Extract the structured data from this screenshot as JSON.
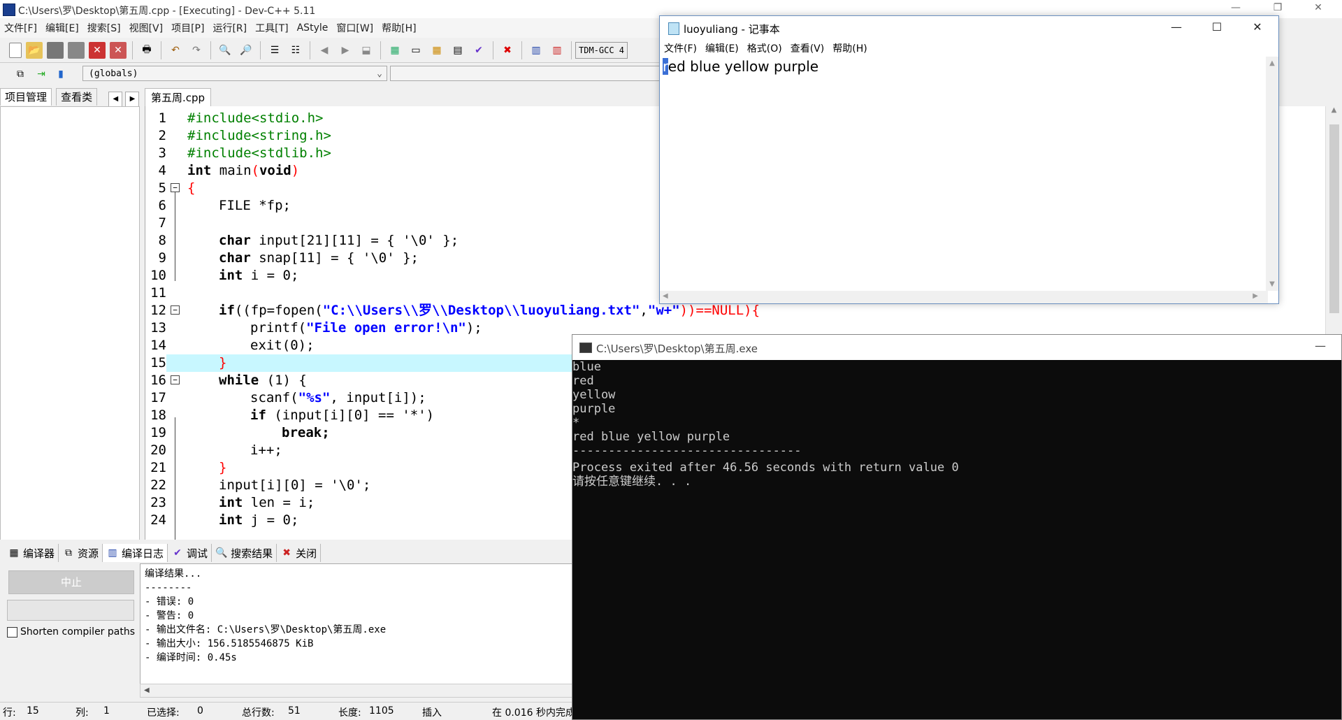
{
  "devcpp": {
    "window_title": "C:\\Users\\罗\\Desktop\\第五周.cpp - [Executing] - Dev-C++ 5.11",
    "menu": [
      "文件[F]",
      "编辑[E]",
      "搜索[S]",
      "视图[V]",
      "项目[P]",
      "运行[R]",
      "工具[T]",
      "AStyle",
      "窗口[W]",
      "帮助[H]"
    ],
    "compiler_label": "TDM-GCC 4",
    "globals_combo": "(globals)",
    "left_tabs": [
      "项目管理",
      "查看类"
    ],
    "editor_tab": "第五周.cpp",
    "code_lines": [
      {
        "n": "1"
      },
      {
        "n": "2"
      },
      {
        "n": "3"
      },
      {
        "n": "4"
      },
      {
        "n": "5"
      },
      {
        "n": "6"
      },
      {
        "n": "7"
      },
      {
        "n": "8"
      },
      {
        "n": "9"
      },
      {
        "n": "10"
      },
      {
        "n": "11"
      },
      {
        "n": "12"
      },
      {
        "n": "13"
      },
      {
        "n": "14"
      },
      {
        "n": "15"
      },
      {
        "n": "16"
      },
      {
        "n": "17"
      },
      {
        "n": "18"
      },
      {
        "n": "19"
      },
      {
        "n": "20"
      },
      {
        "n": "21"
      },
      {
        "n": "22"
      },
      {
        "n": "23"
      },
      {
        "n": "24"
      }
    ],
    "code_text": {
      "l1": "#include<stdio.h>",
      "l2": "#include<string.h>",
      "l3": "#include<stdlib.h>",
      "l4_kw": "int",
      "l4_rest": " main",
      "l4_void": "void",
      "l6": "FILE *fp;",
      "l8_kw": "char",
      "l8_rest": " input[21][11] = { '\\0' };",
      "l9_kw": "char",
      "l9_rest": " snap[11] = { '\\0' };",
      "l10_kw": "int",
      "l10_rest": " i = 0;",
      "l12_kw": "if",
      "l12_a": "((fp=fopen(",
      "l12_str": "\"C:\\\\Users\\\\罗\\\\Desktop\\\\luoyuliang.txt\"",
      "l12_comma": ",",
      "l12_str2": "\"w+\"",
      "l12_b": "))==NULL){",
      "l13_a": "printf(",
      "l13_str": "\"File open error!\\n\"",
      "l13_b": ");",
      "l14": "exit(0);",
      "l16_kw": "while",
      "l16_rest": " (1) {",
      "l17_a": "scanf(",
      "l17_str": "\"%s\"",
      "l17_b": ", input[i]);",
      "l18_kw": "if",
      "l18_rest": " (input[i][0] == '*')",
      "l19": "break;",
      "l20": "i++;",
      "l22": "input[i][0] = '\\0';",
      "l23_kw": "int",
      "l23_rest": " len = i;",
      "l24_kw": "int",
      "l24_rest": " j = 0;"
    },
    "bottom_tabs": [
      "编译器",
      "资源",
      "编译日志",
      "调试",
      "搜索结果",
      "关闭"
    ],
    "stop_button": "中止",
    "shorten_label": "Shorten compiler paths",
    "log_lines": [
      "编译结果...",
      "--------",
      "- 错误: 0",
      "- 警告: 0",
      "- 输出文件名: C:\\Users\\罗\\Desktop\\第五周.exe",
      "- 输出大小: 156.5185546875 KiB",
      "- 编译时间: 0.45s"
    ],
    "status": {
      "row_label": "行:",
      "row_value": "15",
      "col_label": "列:",
      "col_value": "1",
      "sel_label": "已选择:",
      "sel_value": "0",
      "total_label": "总行数:",
      "total_value": "51",
      "len_label": "长度:",
      "len_value": "1105",
      "insert": "插入",
      "parse": "在 0.016 秒内完成"
    }
  },
  "notepad": {
    "title": "luoyuliang - 记事本",
    "menu": [
      "文件(F)",
      "编辑(E)",
      "格式(O)",
      "查看(V)",
      "帮助(H)"
    ],
    "first_char": "r",
    "content_rest": "ed blue yellow purple"
  },
  "console": {
    "title": "C:\\Users\\罗\\Desktop\\第五周.exe",
    "lines": [
      "blue",
      "red",
      "yellow",
      "purple",
      "*",
      "red blue yellow purple",
      "--------------------------------",
      "Process exited after 46.56 seconds with return value 0",
      "请按任意键继续. . ."
    ]
  }
}
